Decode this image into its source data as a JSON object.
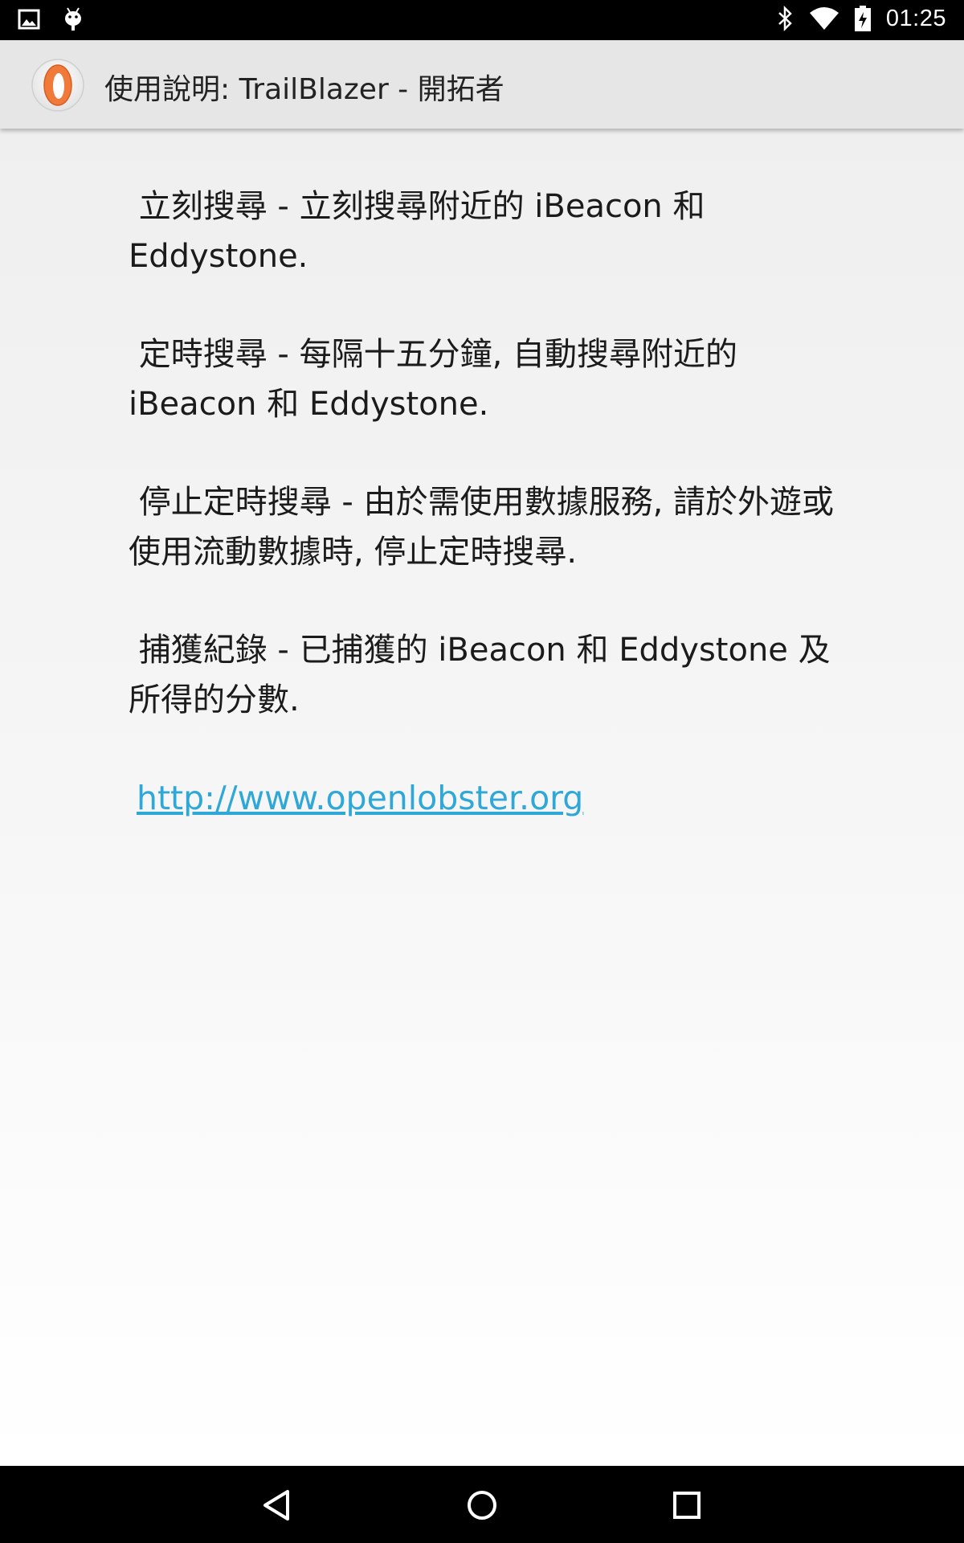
{
  "status_bar": {
    "time": "01:25",
    "left_icons": [
      "image-notification-icon",
      "android-debug-icon"
    ],
    "right_icons": [
      "bluetooth-icon",
      "wifi-icon",
      "battery-charging-icon"
    ]
  },
  "action_bar": {
    "title": "使用說明: TrailBlazer - 開拓者",
    "logo_icon": "openlobster-logo-icon"
  },
  "instructions": [
    " 立刻搜尋 - 立刻搜尋附近的 iBeacon 和 Eddystone.",
    " 定時搜尋 - 每隔十五分鐘, 自動搜尋附近的 iBeacon 和 Eddystone.",
    " 停止定時搜尋 - 由於需使用數據服務, 請於外遊或使用流動數據時, 停止定時搜尋.",
    " 捕獲紀錄 - 已捕獲的 iBeacon 和 Eddystone 及所得的分數."
  ],
  "link": {
    "text": "http://www.openlobster.org"
  },
  "nav_bar": {
    "icons": [
      "back-icon",
      "home-icon",
      "recents-icon"
    ]
  },
  "colors": {
    "link": "#2fa8d8",
    "action_bar": "#e6e6e6",
    "logo_orange": "#f07a3a"
  }
}
